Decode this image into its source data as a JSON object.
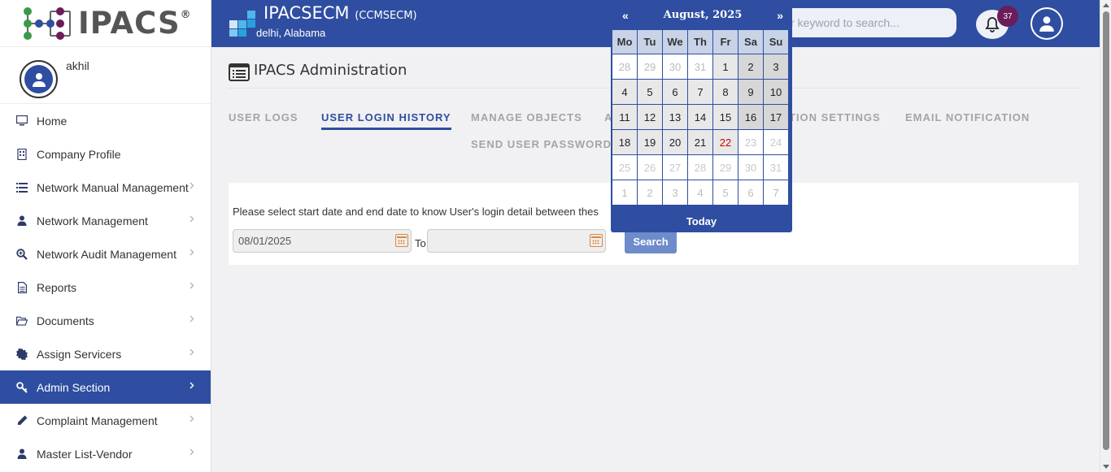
{
  "logo": {
    "text": "IPACS",
    "reg": "®"
  },
  "user": {
    "name": "akhil"
  },
  "sidebar": {
    "items": [
      {
        "label": "Home",
        "icon": "monitor-icon",
        "chevron": false
      },
      {
        "label": "Company Profile",
        "icon": "building-icon",
        "chevron": false
      },
      {
        "label": "Network Manual Management",
        "icon": "list-icon",
        "chevron": true
      },
      {
        "label": "Network Management",
        "icon": "user-icon",
        "chevron": true
      },
      {
        "label": "Network Audit Management",
        "icon": "search-plus-icon",
        "chevron": true
      },
      {
        "label": "Reports",
        "icon": "document-icon",
        "chevron": true
      },
      {
        "label": "Documents",
        "icon": "folder-open-icon",
        "chevron": true
      },
      {
        "label": "Assign Servicers",
        "icon": "cog-icon",
        "chevron": true
      },
      {
        "label": "Admin Section",
        "icon": "key-icon",
        "chevron": true,
        "active": true
      },
      {
        "label": "Complaint Management",
        "icon": "pencil-icon",
        "chevron": true
      },
      {
        "label": "Master List-Vendor",
        "icon": "user-icon",
        "chevron": true
      }
    ]
  },
  "header": {
    "company": "IPACSECM",
    "company_code": "(CCMSECM)",
    "location": "delhi, Alabama",
    "search_placeholder": "r keyword to search...",
    "notification_count": "37"
  },
  "page": {
    "title": "IPACS Administration",
    "tabs": [
      {
        "label": "USER LOGS"
      },
      {
        "label": "USER LOGIN HISTORY",
        "active": true
      },
      {
        "label": "MANAGE OBJECTS"
      },
      {
        "label": "A"
      },
      {
        "label": "TION SETTINGS"
      },
      {
        "label": "EMAIL NOTIFICATION"
      },
      {
        "label": "SEND USER PASSWORDS"
      }
    ],
    "message": "Please select start date and end date to know User's login detail between thes",
    "start_date": "08/01/2025",
    "end_date": "",
    "to_label": "To",
    "search_button": "Search"
  },
  "calendar": {
    "month_label": "August, 2025",
    "prev": "«",
    "next": "»",
    "weekdays": [
      "Mo",
      "Tu",
      "We",
      "Th",
      "Fr",
      "Sa",
      "Su"
    ],
    "weeks": [
      [
        "28",
        "29",
        "30",
        "31",
        "1",
        "2",
        "3"
      ],
      [
        "4",
        "5",
        "6",
        "7",
        "8",
        "9",
        "10"
      ],
      [
        "11",
        "12",
        "13",
        "14",
        "15",
        "16",
        "17"
      ],
      [
        "18",
        "19",
        "20",
        "21",
        "22",
        "23",
        "24"
      ],
      [
        "25",
        "26",
        "27",
        "28",
        "29",
        "30",
        "31"
      ],
      [
        "1",
        "2",
        "3",
        "4",
        "5",
        "6",
        "7"
      ]
    ],
    "today_day": "22",
    "today_label": "Today"
  },
  "colors": {
    "primary": "#2f4ea1",
    "today_red": "#cc0000",
    "badge": "#6a1d5a"
  }
}
